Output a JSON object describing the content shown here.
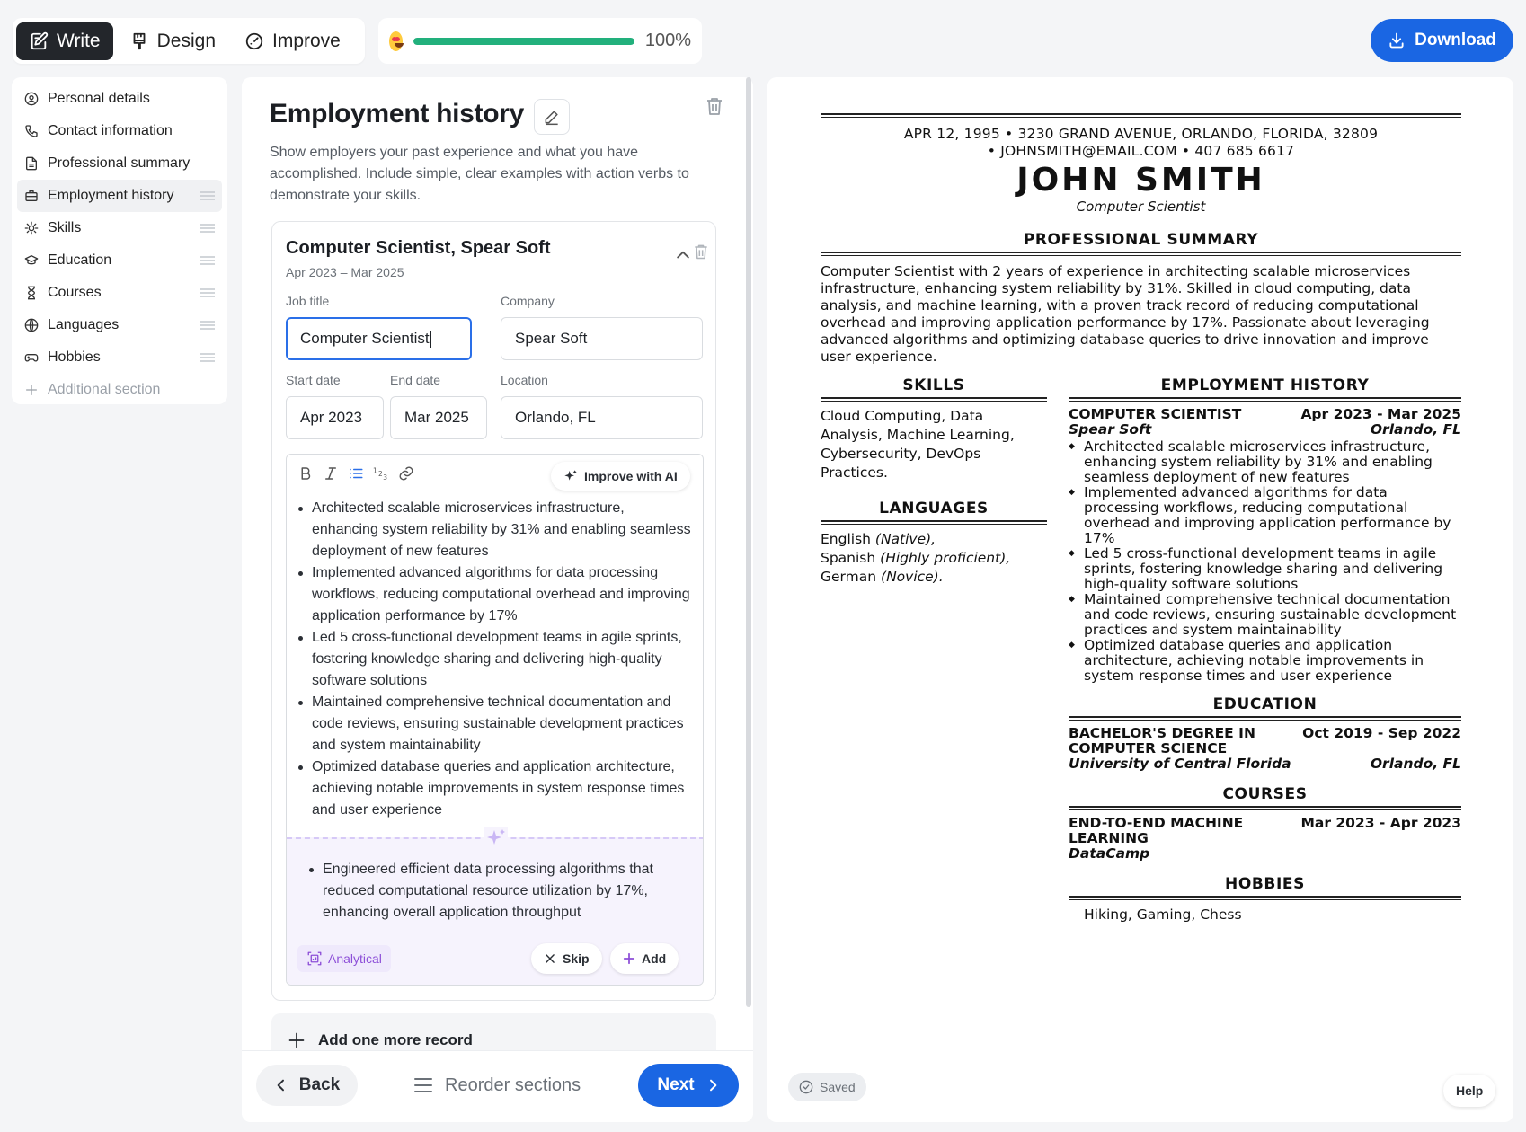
{
  "topbar": {
    "tabs": [
      {
        "label": "Write",
        "icon": "pencil-doc-icon",
        "active": true
      },
      {
        "label": "Design",
        "icon": "brush-icon",
        "active": false
      },
      {
        "label": "Improve",
        "icon": "gauge-icon",
        "active": false
      }
    ],
    "progress": {
      "label": "100%",
      "value": 100
    },
    "download_label": "Download"
  },
  "sidebar": {
    "items": [
      {
        "label": "Personal details",
        "icon": "user-circle-icon"
      },
      {
        "label": "Contact information",
        "icon": "phone-icon"
      },
      {
        "label": "Professional summary",
        "icon": "document-icon"
      },
      {
        "label": "Employment history",
        "icon": "briefcase-icon",
        "active": true
      },
      {
        "label": "Skills",
        "icon": "sparkle-icon"
      },
      {
        "label": "Education",
        "icon": "graduation-cap-icon"
      },
      {
        "label": "Courses",
        "icon": "hourglass-icon"
      },
      {
        "label": "Languages",
        "icon": "globe-icon"
      },
      {
        "label": "Hobbies",
        "icon": "gamepad-icon"
      }
    ],
    "additional_section": "Additional section"
  },
  "editor": {
    "title": "Employment history",
    "description": "Show employers your past experience and what you have accomplished. Include simple, clear examples with action verbs to demonstrate your skills.",
    "record": {
      "title": "Computer Scientist, Spear Soft",
      "dates": "Apr 2023 – Mar 2025",
      "job_title_label": "Job title",
      "job_title": "Computer Scientist",
      "company_label": "Company",
      "company": "Spear Soft",
      "start_label": "Start date",
      "start": "Apr 2023",
      "end_label": "End date",
      "end": "Mar 2025",
      "location_label": "Location",
      "location": "Orlando, FL",
      "improve_ai": "Improve with AI",
      "bullets": [
        "Architected scalable microservices infrastructure, enhancing system reliability by 31% and enabling seamless deployment of new features",
        "Implemented advanced algorithms for data processing workflows, reducing computational overhead and improving application performance by 17%",
        "Led 5 cross-functional development teams in agile sprints, fostering knowledge sharing and delivering high-quality software solutions",
        "Maintained comprehensive technical documentation and code reviews, ensuring sustainable development practices and system maintainability",
        "Optimized database queries and application architecture, achieving notable improvements in system response times and user experience"
      ],
      "suggestion": "Engineered efficient data processing algorithms that reduced computational resource utilization by 17%, enhancing overall application throughput",
      "suggestion_tag": "Analytical",
      "skip_label": "Skip",
      "add_label": "Add"
    },
    "add_record": "Add one more record",
    "back_label": "Back",
    "reorder_label": "Reorder sections",
    "next_label": "Next"
  },
  "preview": {
    "contact_line1": "APR 12, 1995 • 3230 GRAND AVENUE, ORLANDO, FLORIDA, 32809",
    "contact_line2": "• JOHNSMITH@EMAIL.COM • 407 685 6617",
    "name": "JOHN SMITH",
    "role": "Computer Scientist",
    "summary_heading": "PROFESSIONAL SUMMARY",
    "summary": "Computer Scientist with 2 years of experience in architecting scalable microservices infrastructure, enhancing system reliability by 31%. Skilled in cloud computing, data analysis, and machine learning, with a proven track record of reducing computational overhead and improving application performance by 17%. Passionate about leveraging advanced algorithms and optimizing database queries to drive innovation and improve user experience.",
    "skills_heading": "SKILLS",
    "skills": "Cloud Computing, Data Analysis, Machine Learning, Cybersecurity, DevOps Practices.",
    "languages_heading": "LANGUAGES",
    "languages": [
      {
        "name": "English",
        "level": "(Native),"
      },
      {
        "name": "Spanish",
        "level": "(Highly proficient),"
      },
      {
        "name": "German",
        "level": "(Novice)."
      }
    ],
    "employment_heading": "EMPLOYMENT HISTORY",
    "job_title": "COMPUTER SCIENTIST",
    "job_dates": "Apr 2023 - Mar 2025",
    "job_company": "Spear Soft",
    "job_location": "Orlando, FL",
    "education_heading": "EDUCATION",
    "edu_degree": "BACHELOR'S DEGREE IN COMPUTER SCIENCE",
    "edu_dates": "Oct 2019 - Sep 2022",
    "edu_school": "University of Central Florida",
    "edu_location": "Orlando, FL",
    "courses_heading": "COURSES",
    "course_title": "END-TO-END MACHINE LEARNING",
    "course_dates": "Mar 2023 - Apr 2023",
    "course_provider": "DataCamp",
    "hobbies_heading": "HOBBIES",
    "hobbies": "Hiking, Gaming, Chess",
    "saved_label": "Saved",
    "help_label": "Help"
  },
  "colors": {
    "accent": "#1a66e3",
    "progress": "#22b07c",
    "ai_purple": "#8d4fd8"
  }
}
